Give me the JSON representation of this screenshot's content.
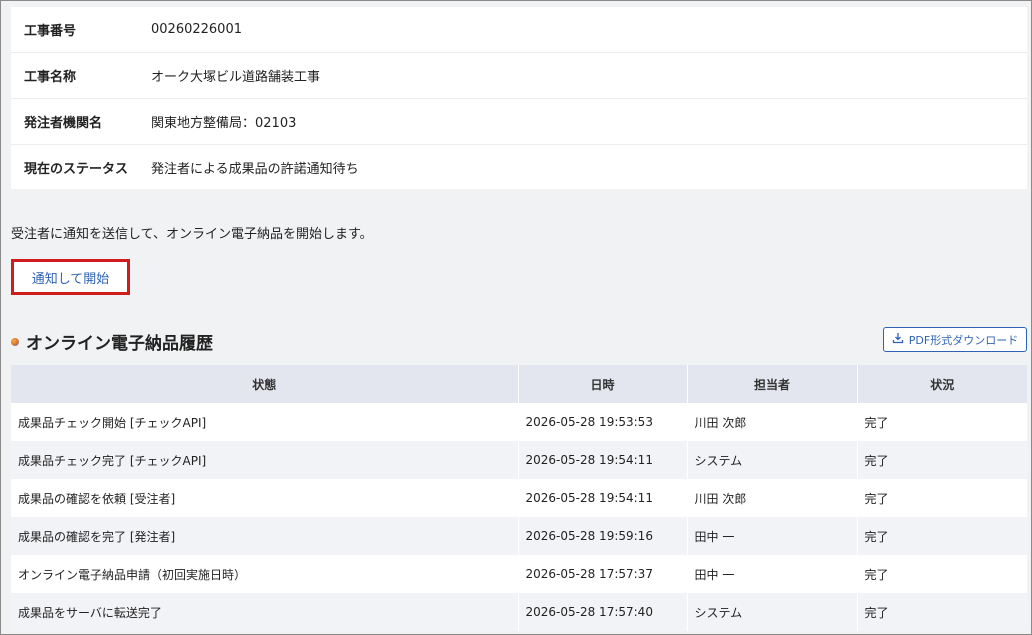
{
  "info": {
    "rows": [
      {
        "label": "工事番号",
        "value": "00260226001"
      },
      {
        "label": "工事名称",
        "value": "オーク大塚ビル道路舗装工事"
      },
      {
        "label": "発注者機関名",
        "value": "関東地方整備局：02103"
      },
      {
        "label": "現在のステータス",
        "value": "発注者による成果品の許諾通知待ち"
      }
    ]
  },
  "description": "受注者に通知を送信して、オンライン電子納品を開始します。",
  "start_button": "通知して開始",
  "history": {
    "title": "オンライン電子納品履歴",
    "pdf_button": "PDF形式ダウンロード",
    "columns": [
      "状態",
      "日時",
      "担当者",
      "状況"
    ],
    "rows": [
      [
        "成果品チェック開始 [チェックAPI]",
        "2026-05-28 19:53:53",
        "川田 次郎",
        "完了"
      ],
      [
        "成果品チェック完了 [チェックAPI]",
        "2026-05-28 19:54:11",
        "システム",
        "完了"
      ],
      [
        "成果品の確認を依頼 [受注者]",
        "2026-05-28 19:54:11",
        "川田 次郎",
        "完了"
      ],
      [
        "成果品の確認を完了 [発注者]",
        "2026-05-28 19:59:16",
        "田中 一",
        "完了"
      ],
      [
        "オンライン電子納品申請（初回実施日時）",
        "2026-05-28 17:57:37",
        "田中 一",
        "完了"
      ],
      [
        "成果品をサーバに転送完了",
        "2026-05-28 17:57:40",
        "システム",
        "完了"
      ]
    ]
  },
  "colors": {
    "accent": "#2f62b5",
    "highlight_border": "#d01c1c",
    "header_bg": "#e3e6ee"
  }
}
